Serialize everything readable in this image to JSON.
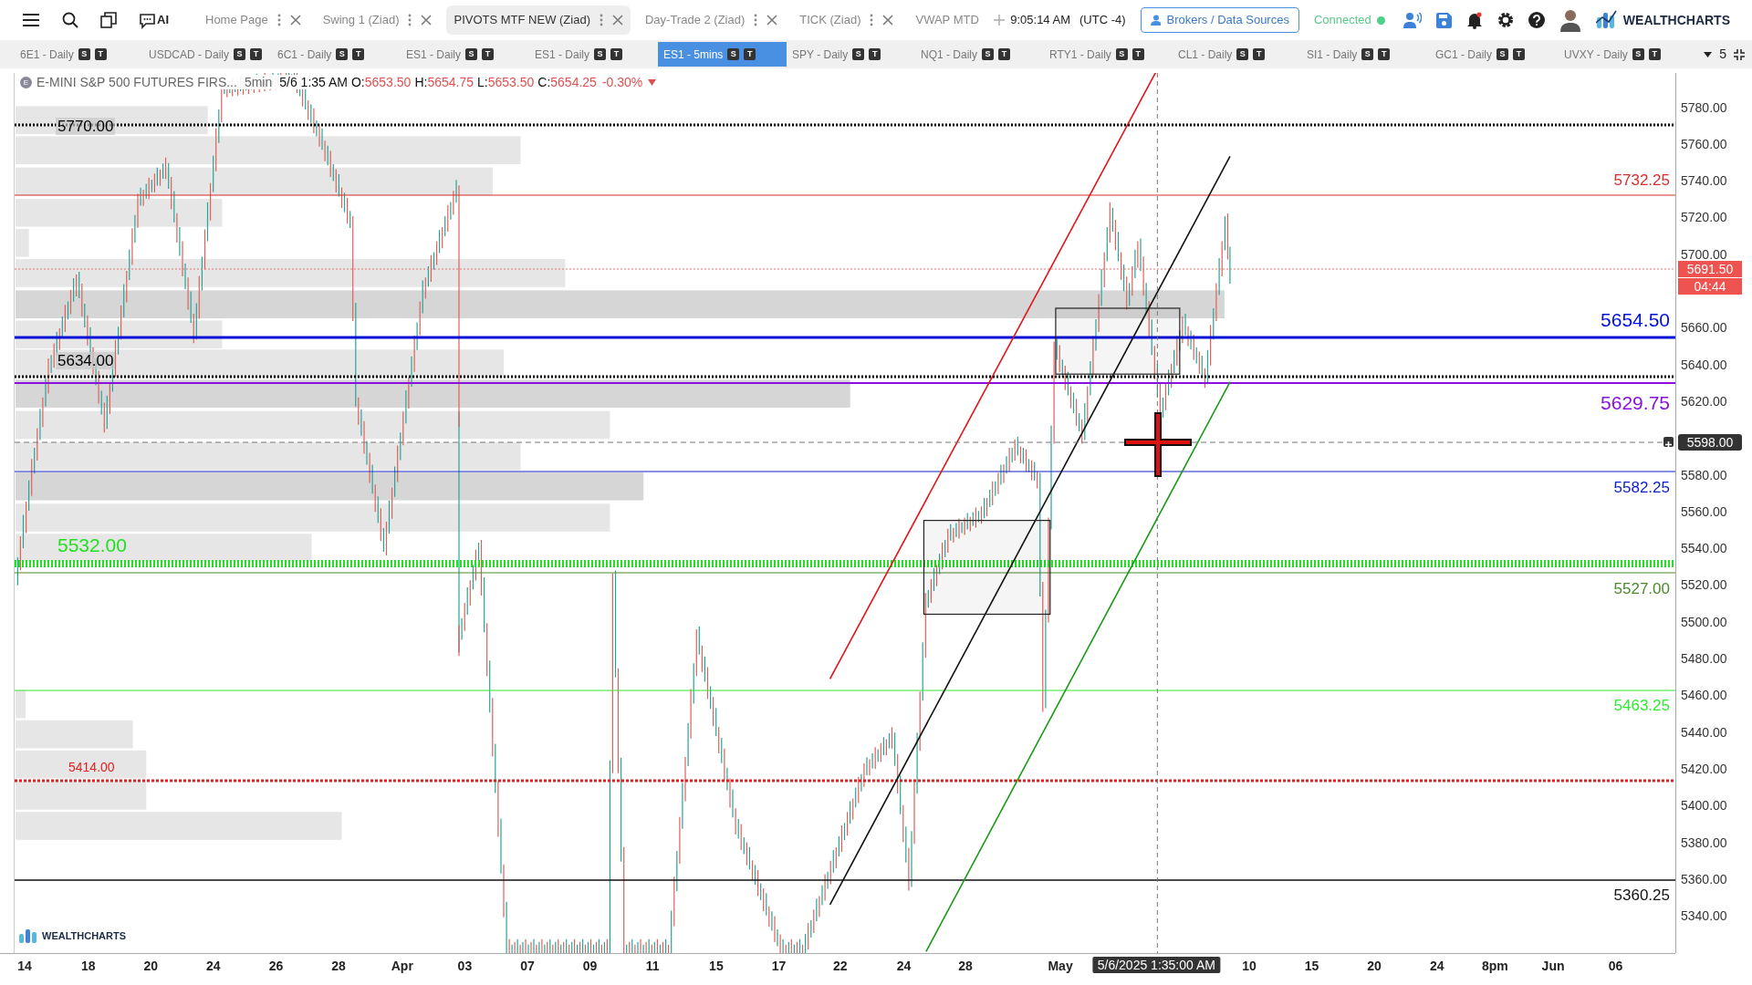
{
  "toolbar": {
    "tabs": [
      {
        "label": "Home Page",
        "selected": false
      },
      {
        "label": "Swing 1 (Ziad)",
        "selected": false
      },
      {
        "label": "PIVOTS MTF NEW (Ziad)",
        "selected": true
      },
      {
        "label": "Day-Trade 2 (Ziad)",
        "selected": false
      },
      {
        "label": "TICK (Ziad)",
        "selected": false
      },
      {
        "label": "VWAP MTD",
        "selected": false
      }
    ],
    "ai_label": "AI",
    "time": "9:05:14 AM",
    "timezone": "(UTC -4)",
    "brokers_button": "Brokers / Data Sources",
    "status": "Connected",
    "logo": "WEALTHCHARTS"
  },
  "chart_tabs": [
    {
      "label": "6E1 - Daily",
      "selected": false,
      "badges": [
        "S",
        "T"
      ]
    },
    {
      "label": "USDCAD - Daily",
      "selected": false,
      "badges": [
        "S",
        "T"
      ]
    },
    {
      "label": "6C1 - Daily",
      "selected": false,
      "badges": [
        "S",
        "T"
      ]
    },
    {
      "label": "ES1 - Daily",
      "selected": false,
      "badges": [
        "S",
        "T"
      ]
    },
    {
      "label": "ES1 - Daily",
      "selected": false,
      "badges": [
        "S",
        "T"
      ]
    },
    {
      "label": "ES1 - 5mins",
      "selected": true,
      "badges": [
        "S",
        "T"
      ]
    },
    {
      "label": "SPY - Daily",
      "selected": false,
      "badges": [
        "S",
        "T"
      ]
    },
    {
      "label": "NQ1 - Daily",
      "selected": false,
      "badges": [
        "S",
        "T"
      ]
    },
    {
      "label": "RTY1 - Daily",
      "selected": false,
      "badges": [
        "S",
        "T"
      ]
    },
    {
      "label": "CL1 - Daily",
      "selected": false,
      "badges": [
        "S",
        "T"
      ]
    },
    {
      "label": "SI1 - Daily",
      "selected": false,
      "badges": [
        "S",
        "T"
      ]
    },
    {
      "label": "GC1 - Daily",
      "selected": false,
      "badges": [
        "S",
        "T"
      ]
    },
    {
      "label": "UVXY - Daily",
      "selected": false,
      "badges": [
        "S",
        "T"
      ]
    }
  ],
  "layout_count": "5",
  "legend": {
    "symbol_badge": "E",
    "symbol": "E-MINI S&P 500 FUTURES FIRS...",
    "interval": "5min",
    "datetime": "5/6 1:35 AM",
    "ohlc": [
      {
        "label": "O:",
        "value": "5653.50"
      },
      {
        "label": "H:",
        "value": "5654.75"
      },
      {
        "label": "L:",
        "value": "5653.50"
      },
      {
        "label": "C:",
        "value": "5654.25"
      }
    ],
    "change": "-0.30%"
  },
  "levels": [
    {
      "label": "5770.00",
      "color": "#000000",
      "kind": "left"
    },
    {
      "label": "5732.25",
      "color": "#d32f2f",
      "kind": "right"
    },
    {
      "label": "5654.50",
      "color": "#0010d8",
      "kind": "right"
    },
    {
      "label": "5634.00",
      "color": "#000000",
      "kind": "left"
    },
    {
      "label": "5629.75",
      "color": "#8a10e0",
      "kind": "right"
    },
    {
      "label": "5582.25",
      "color": "#1020c8",
      "kind": "right"
    },
    {
      "label": "5532.00",
      "color": "#22e022",
      "kind": "left"
    },
    {
      "label": "5527.00",
      "color": "#4a8a2a",
      "kind": "right"
    },
    {
      "label": "5463.25",
      "color": "#33e833",
      "kind": "right"
    },
    {
      "label": "5414.00",
      "color": "#e02020",
      "kind": "left"
    },
    {
      "label": "5360.25",
      "color": "#111111",
      "kind": "right"
    }
  ],
  "y_ticks": [
    "5780.00",
    "5760.00",
    "5740.00",
    "5720.00",
    "5700.00",
    "5660.00",
    "5640.00",
    "5620.00",
    "5580.00",
    "5560.00",
    "5540.00",
    "5520.00",
    "5500.00",
    "5480.00",
    "5460.00",
    "5440.00",
    "5420.00",
    "5400.00",
    "5380.00",
    "5360.00",
    "5340.00"
  ],
  "last_price": "5691.50",
  "countdown": "04:44",
  "crosshair_price": "5598.00",
  "x_ticks": [
    "14",
    "18",
    "20",
    "24",
    "26",
    "28",
    "Apr",
    "03",
    "07",
    "09",
    "11",
    "15",
    "17",
    "22",
    "24",
    "28",
    "May",
    "10",
    "15",
    "20",
    "24",
    "8pm",
    "Jun",
    "06"
  ],
  "crosshair_time": "5/6/2025 1:35:00 AM",
  "chart_logo": "WEALTHCHARTS"
}
